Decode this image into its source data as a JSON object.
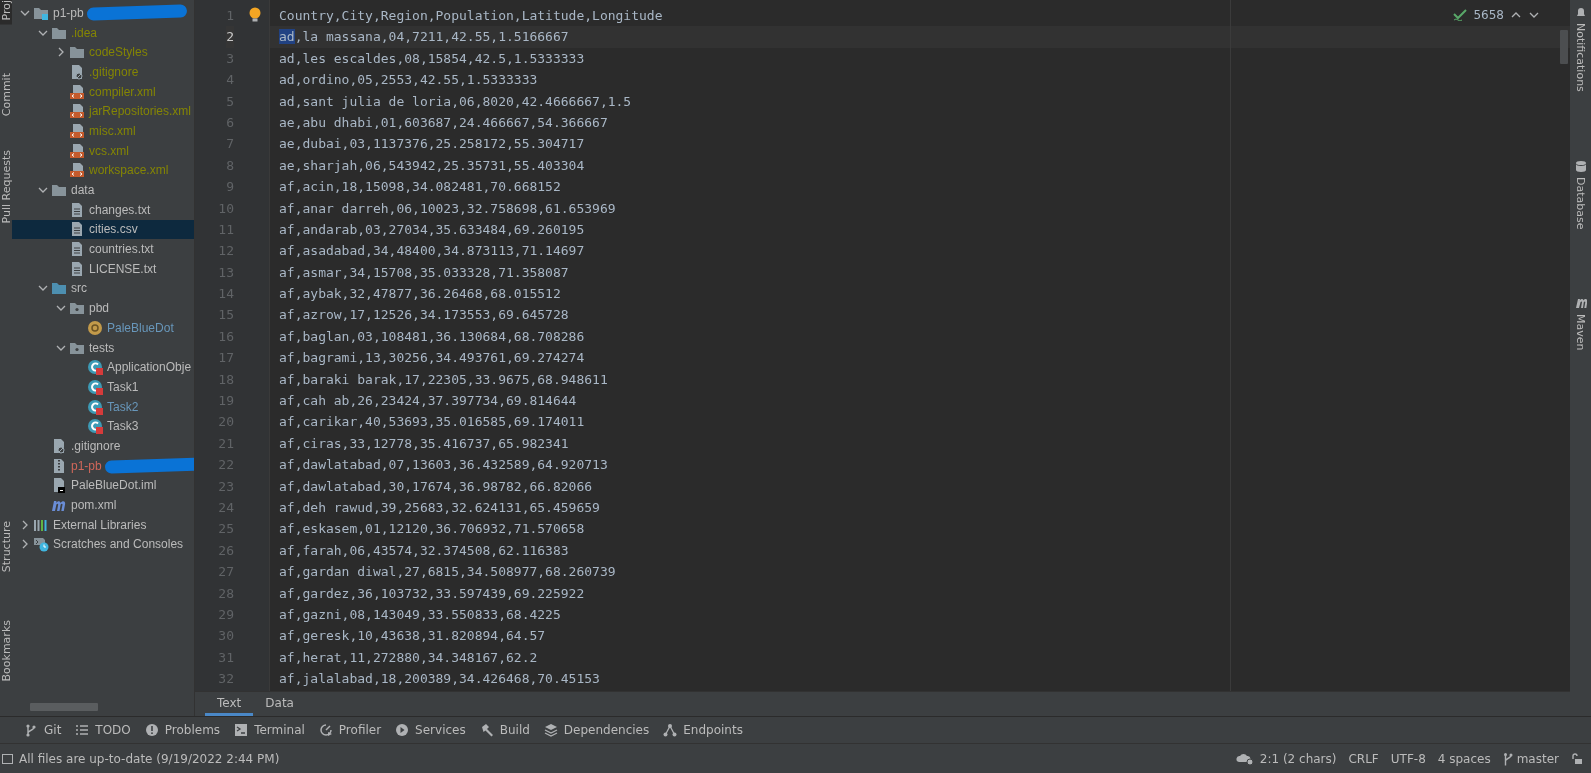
{
  "left_strip": [
    {
      "label": "Proj",
      "selected": true
    },
    {
      "label": "Commit",
      "selected": false
    },
    {
      "label": "Pull Requests",
      "selected": false
    },
    {
      "label": "Structure",
      "selected": false
    },
    {
      "label": "Bookmarks",
      "selected": false
    }
  ],
  "project_tree": [
    {
      "label": "p1-pb",
      "kind": "project",
      "expanded": true,
      "redacted": true,
      "color": "#bbbbbb",
      "selected": false,
      "children": [
        {
          "label": ".idea",
          "kind": "folder",
          "expanded": true,
          "color": "#848504",
          "selected": false,
          "children": [
            {
              "label": "codeStyles",
              "kind": "folder",
              "expanded": false,
              "color": "#848504",
              "selected": false
            },
            {
              "label": ".gitignore",
              "kind": "ignore",
              "color": "#848504",
              "selected": false
            },
            {
              "label": "compiler.xml",
              "kind": "xml",
              "color": "#848504",
              "selected": false
            },
            {
              "label": "jarRepositories.xml",
              "kind": "xml",
              "color": "#848504",
              "selected": false
            },
            {
              "label": "misc.xml",
              "kind": "xml",
              "color": "#848504",
              "selected": false
            },
            {
              "label": "vcs.xml",
              "kind": "xml",
              "color": "#848504",
              "selected": false
            },
            {
              "label": "workspace.xml",
              "kind": "xml",
              "color": "#848504",
              "selected": false
            }
          ]
        },
        {
          "label": "data",
          "kind": "folder",
          "expanded": true,
          "color": "#bbbbbb",
          "selected": false,
          "children": [
            {
              "label": "changes.txt",
              "kind": "text",
              "color": "#bbbbbb",
              "selected": false
            },
            {
              "label": "cities.csv",
              "kind": "text",
              "color": "#bbbbbb",
              "selected": true
            },
            {
              "label": "countries.txt",
              "kind": "text",
              "color": "#bbbbbb",
              "selected": false
            },
            {
              "label": "LICENSE.txt",
              "kind": "text",
              "color": "#bbbbbb",
              "selected": false
            }
          ]
        },
        {
          "label": "src",
          "kind": "source",
          "expanded": true,
          "color": "#bbbbbb",
          "selected": false,
          "children": [
            {
              "label": "pbd",
              "kind": "package",
              "expanded": true,
              "color": "#bbbbbb",
              "selected": false,
              "children": [
                {
                  "label": "PaleBlueDot",
                  "kind": "main",
                  "color": "#6897bb",
                  "selected": false
                }
              ]
            },
            {
              "label": "tests",
              "kind": "package",
              "expanded": true,
              "color": "#bbbbbb",
              "selected": false,
              "children": [
                {
                  "label": "ApplicationObje",
                  "kind": "test",
                  "color": "#bbbbbb",
                  "selected": false
                },
                {
                  "label": "Task1",
                  "kind": "test",
                  "color": "#bbbbbb",
                  "selected": false
                },
                {
                  "label": "Task2",
                  "kind": "test",
                  "color": "#6897bb",
                  "selected": false
                },
                {
                  "label": "Task3",
                  "kind": "test",
                  "color": "#bbbbbb",
                  "selected": false
                }
              ]
            }
          ]
        },
        {
          "label": ".gitignore",
          "kind": "ignore",
          "color": "#bbbbbb",
          "selected": false
        },
        {
          "label": "p1-pb",
          "kind": "zip",
          "redacted": true,
          "color": "#d1675a",
          "selected": false
        },
        {
          "label": "PaleBlueDot.iml",
          "kind": "iml",
          "color": "#bbbbbb",
          "selected": false
        },
        {
          "label": "pom.xml",
          "kind": "maven",
          "color": "#bbbbbb",
          "selected": false
        }
      ]
    },
    {
      "label": "External Libraries",
      "kind": "libraries",
      "expanded": false,
      "color": "#bbbbbb",
      "selected": false
    },
    {
      "label": "Scratches and Consoles",
      "kind": "scratches",
      "expanded": false,
      "color": "#bbbbbb",
      "selected": false
    }
  ],
  "editor": {
    "inspection_count": "5658",
    "lines": [
      {
        "number": "1",
        "text": "Country,City,Region,Population,Latitude,Longitude",
        "selected": false
      },
      {
        "number": "2",
        "selection": "ad",
        "text": ",la massana,04,7211,42.55,1.5166667",
        "selected": true
      },
      {
        "number": "3",
        "text": "ad,les escaldes,08,15854,42.5,1.5333333",
        "selected": false
      },
      {
        "number": "4",
        "text": "ad,ordino,05,2553,42.55,1.5333333",
        "selected": false
      },
      {
        "number": "5",
        "text": "ad,sant julia de loria,06,8020,42.4666667,1.5",
        "selected": false
      },
      {
        "number": "6",
        "text": "ae,abu dhabi,01,603687,24.466667,54.366667",
        "selected": false
      },
      {
        "number": "7",
        "text": "ae,dubai,03,1137376,25.258172,55.304717",
        "selected": false
      },
      {
        "number": "8",
        "text": "ae,sharjah,06,543942,25.35731,55.403304",
        "selected": false
      },
      {
        "number": "9",
        "text": "af,acin,18,15098,34.082481,70.668152",
        "selected": false
      },
      {
        "number": "10",
        "text": "af,anar darreh,06,10023,32.758698,61.653969",
        "selected": false
      },
      {
        "number": "11",
        "text": "af,andarab,03,27034,35.633484,69.260195",
        "selected": false
      },
      {
        "number": "12",
        "text": "af,asadabad,34,48400,34.873113,71.14697",
        "selected": false
      },
      {
        "number": "13",
        "text": "af,asmar,34,15708,35.033328,71.358087",
        "selected": false
      },
      {
        "number": "14",
        "text": "af,aybak,32,47877,36.26468,68.015512",
        "selected": false
      },
      {
        "number": "15",
        "text": "af,azrow,17,12526,34.173553,69.645728",
        "selected": false
      },
      {
        "number": "16",
        "text": "af,baglan,03,108481,36.130684,68.708286",
        "selected": false
      },
      {
        "number": "17",
        "text": "af,bagrami,13,30256,34.493761,69.274274",
        "selected": false
      },
      {
        "number": "18",
        "text": "af,baraki barak,17,22305,33.9675,68.948611",
        "selected": false
      },
      {
        "number": "19",
        "text": "af,cah ab,26,23424,37.397734,69.814644",
        "selected": false
      },
      {
        "number": "20",
        "text": "af,carikar,40,53693,35.016585,69.174011",
        "selected": false
      },
      {
        "number": "21",
        "text": "af,ciras,33,12778,35.416737,65.982341",
        "selected": false
      },
      {
        "number": "22",
        "text": "af,dawlatabad,07,13603,36.432589,64.920713",
        "selected": false
      },
      {
        "number": "23",
        "text": "af,dawlatabad,30,17674,36.98782,66.82066",
        "selected": false
      },
      {
        "number": "24",
        "text": "af,deh rawud,39,25683,32.624131,65.459659",
        "selected": false
      },
      {
        "number": "25",
        "text": "af,eskasem,01,12120,36.706932,71.570658",
        "selected": false
      },
      {
        "number": "26",
        "text": "af,farah,06,43574,32.374508,62.116383",
        "selected": false
      },
      {
        "number": "27",
        "text": "af,gardan diwal,27,6815,34.508977,68.260739",
        "selected": false
      },
      {
        "number": "28",
        "text": "af,gardez,36,103732,33.597439,69.225922",
        "selected": false
      },
      {
        "number": "29",
        "text": "af,gazni,08,143049,33.550833,68.4225",
        "selected": false
      },
      {
        "number": "30",
        "text": "af,geresk,10,43638,31.820894,64.57",
        "selected": false
      },
      {
        "number": "31",
        "text": "af,herat,11,272880,34.348167,62.2",
        "selected": false
      },
      {
        "number": "32",
        "text": "af,jalalabad,18,200389,34.426468,70.45153",
        "selected": false
      }
    ],
    "tabs": [
      {
        "label": "Text",
        "selected": true
      },
      {
        "label": "Data",
        "selected": false
      }
    ]
  },
  "right_strip": [
    {
      "label": "Notifications",
      "kind": "bell"
    },
    {
      "label": "Database",
      "kind": "database"
    },
    {
      "label": "Maven",
      "kind": "maven"
    }
  ],
  "tool_windows": [
    {
      "label": "Git",
      "kind": "branch"
    },
    {
      "label": "TODO",
      "kind": "list"
    },
    {
      "label": "Problems",
      "kind": "alert"
    },
    {
      "label": "Terminal",
      "kind": "terminal"
    },
    {
      "label": "Profiler",
      "kind": "profiler"
    },
    {
      "label": "Services",
      "kind": "play"
    },
    {
      "label": "Build",
      "kind": "hammer"
    },
    {
      "label": "Dependencies",
      "kind": "layers"
    },
    {
      "label": "Endpoints",
      "kind": "nodes"
    }
  ],
  "status_bar": {
    "message": "All files are up-to-date (9/19/2022 2:44 PM)",
    "position": "2:1 (2 chars)",
    "line_separator": "CRLF",
    "encoding": "UTF-8",
    "indent": "4 spaces",
    "branch": "master"
  }
}
